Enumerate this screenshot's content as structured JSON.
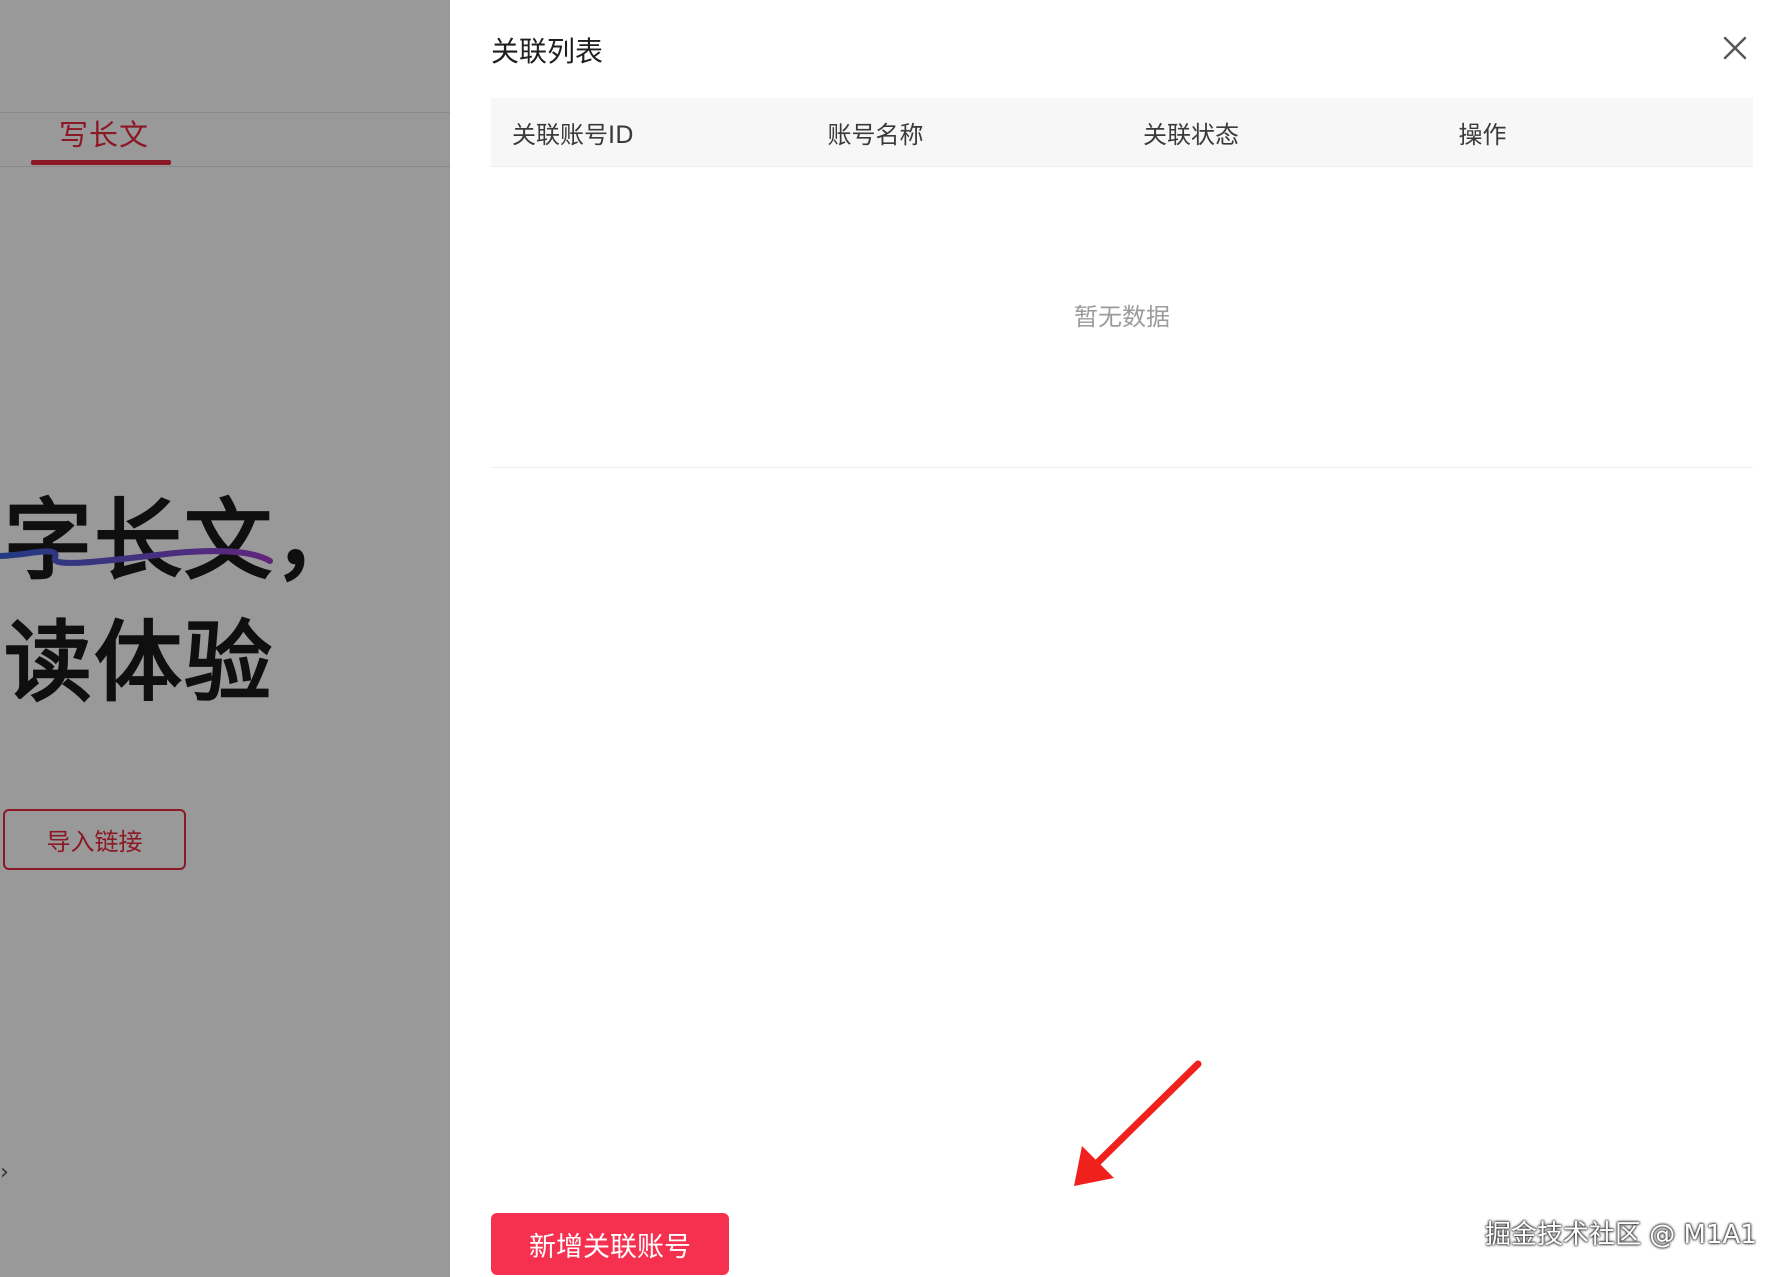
{
  "background_page": {
    "tab_label": "写长文",
    "hero_line1": "字长文，",
    "hero_line2": "读体验",
    "import_button_label": "导入链接",
    "chevron": "›"
  },
  "drawer": {
    "title": "关联列表",
    "close_icon": "close-icon",
    "table": {
      "columns": [
        "关联账号ID",
        "账号名称",
        "关联状态",
        "操作"
      ],
      "rows": [],
      "empty_text": "暂无数据"
    },
    "add_button_label": "新增关联账号"
  },
  "annotation": {
    "arrow_color": "#f0201c"
  },
  "watermark": "掘金技术社区 @ M1A1",
  "colors": {
    "accent": "#e8293f",
    "primary_button": "#f5314f"
  }
}
